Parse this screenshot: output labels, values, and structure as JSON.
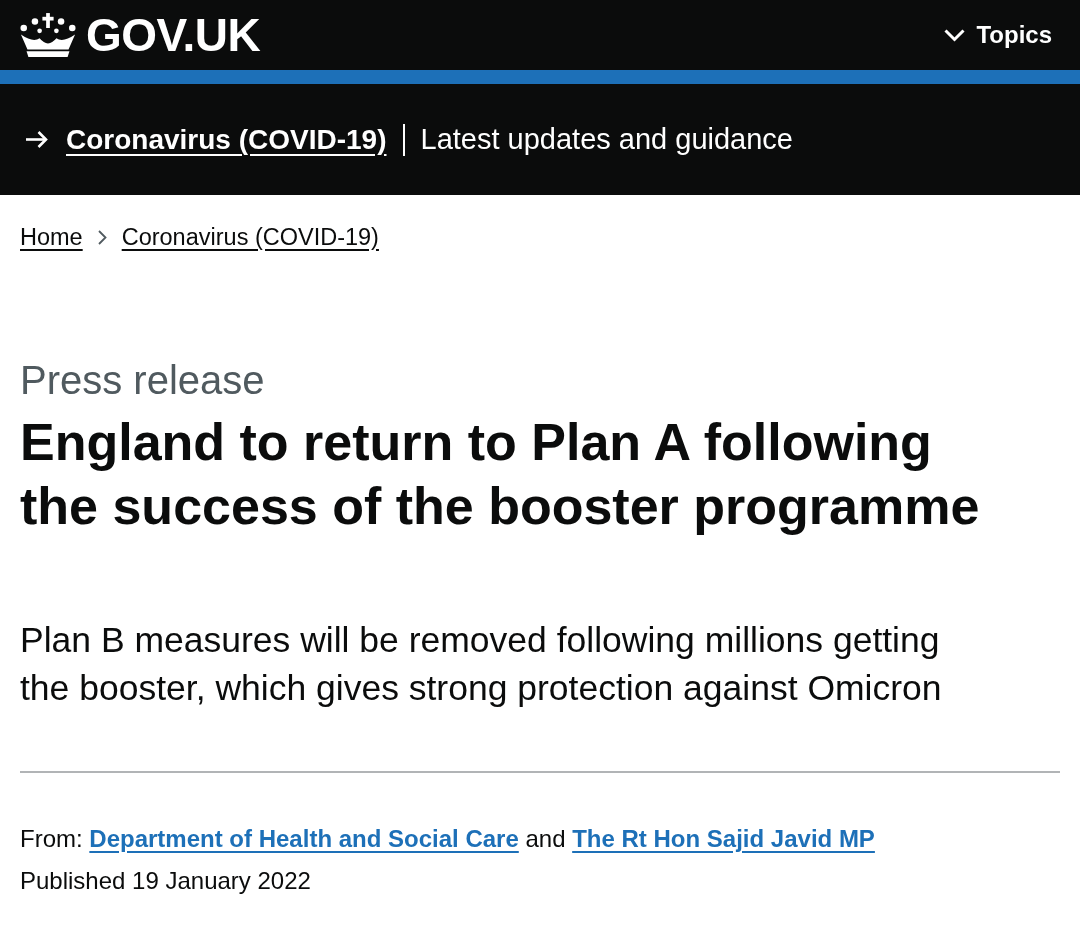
{
  "header": {
    "logo_text": "GOV.UK",
    "menu_button": {
      "label": "Topics",
      "expanded": false
    }
  },
  "banner": {
    "link": "Coronavirus (COVID-19)",
    "description": "Latest updates and guidance"
  },
  "breadcrumbs": [
    "Home",
    "Coronavirus (COVID-19)"
  ],
  "article": {
    "document_type": "Press release",
    "title": "England to return to Plan A following the success of the booster programme",
    "summary": "Plan B measures will be removed following millions getting the booster, which gives strong protection against Omicron",
    "from_label": "From:",
    "organisations": [
      "Department of Health and Social Care",
      "The Rt Hon Sajid Javid MP"
    ],
    "conjunction": "and",
    "published": "Published 19 January 2022"
  }
}
